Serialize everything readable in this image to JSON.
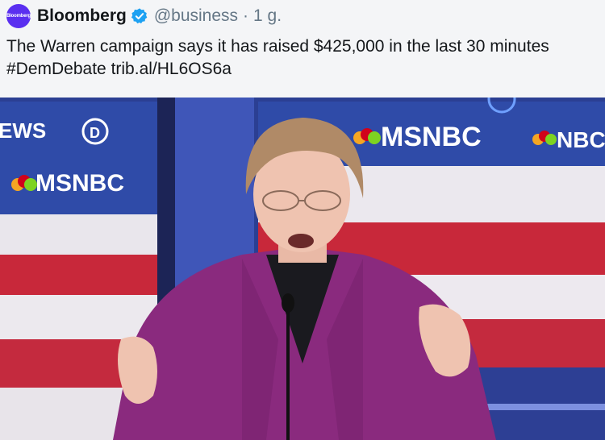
{
  "tweet": {
    "avatar_text": "Bloomberg",
    "display_name": "Bloomberg",
    "handle": "@business",
    "separator": "·",
    "time": "1 g.",
    "text": "The Warren campaign says it has raised $425,000 in the last 30 minutes #DemDebate trib.al/HL6OS6a"
  },
  "media": {
    "signs": {
      "left_top": "EWS",
      "left_main": "MSNBC",
      "center_main": "MSNBC",
      "right_main": "NBC"
    }
  },
  "colors": {
    "avatar": "#5a2ff0",
    "verified": "#1da1f2",
    "jacket": "#8a2a7e",
    "backdrop_blue": "#2a3b8a",
    "stripe_red": "#c8283a"
  },
  "icons": {
    "verified": "verified-badge-icon",
    "nbc_peacock": "peacock-icon",
    "democrat_logo": "democrat-d-icon"
  }
}
